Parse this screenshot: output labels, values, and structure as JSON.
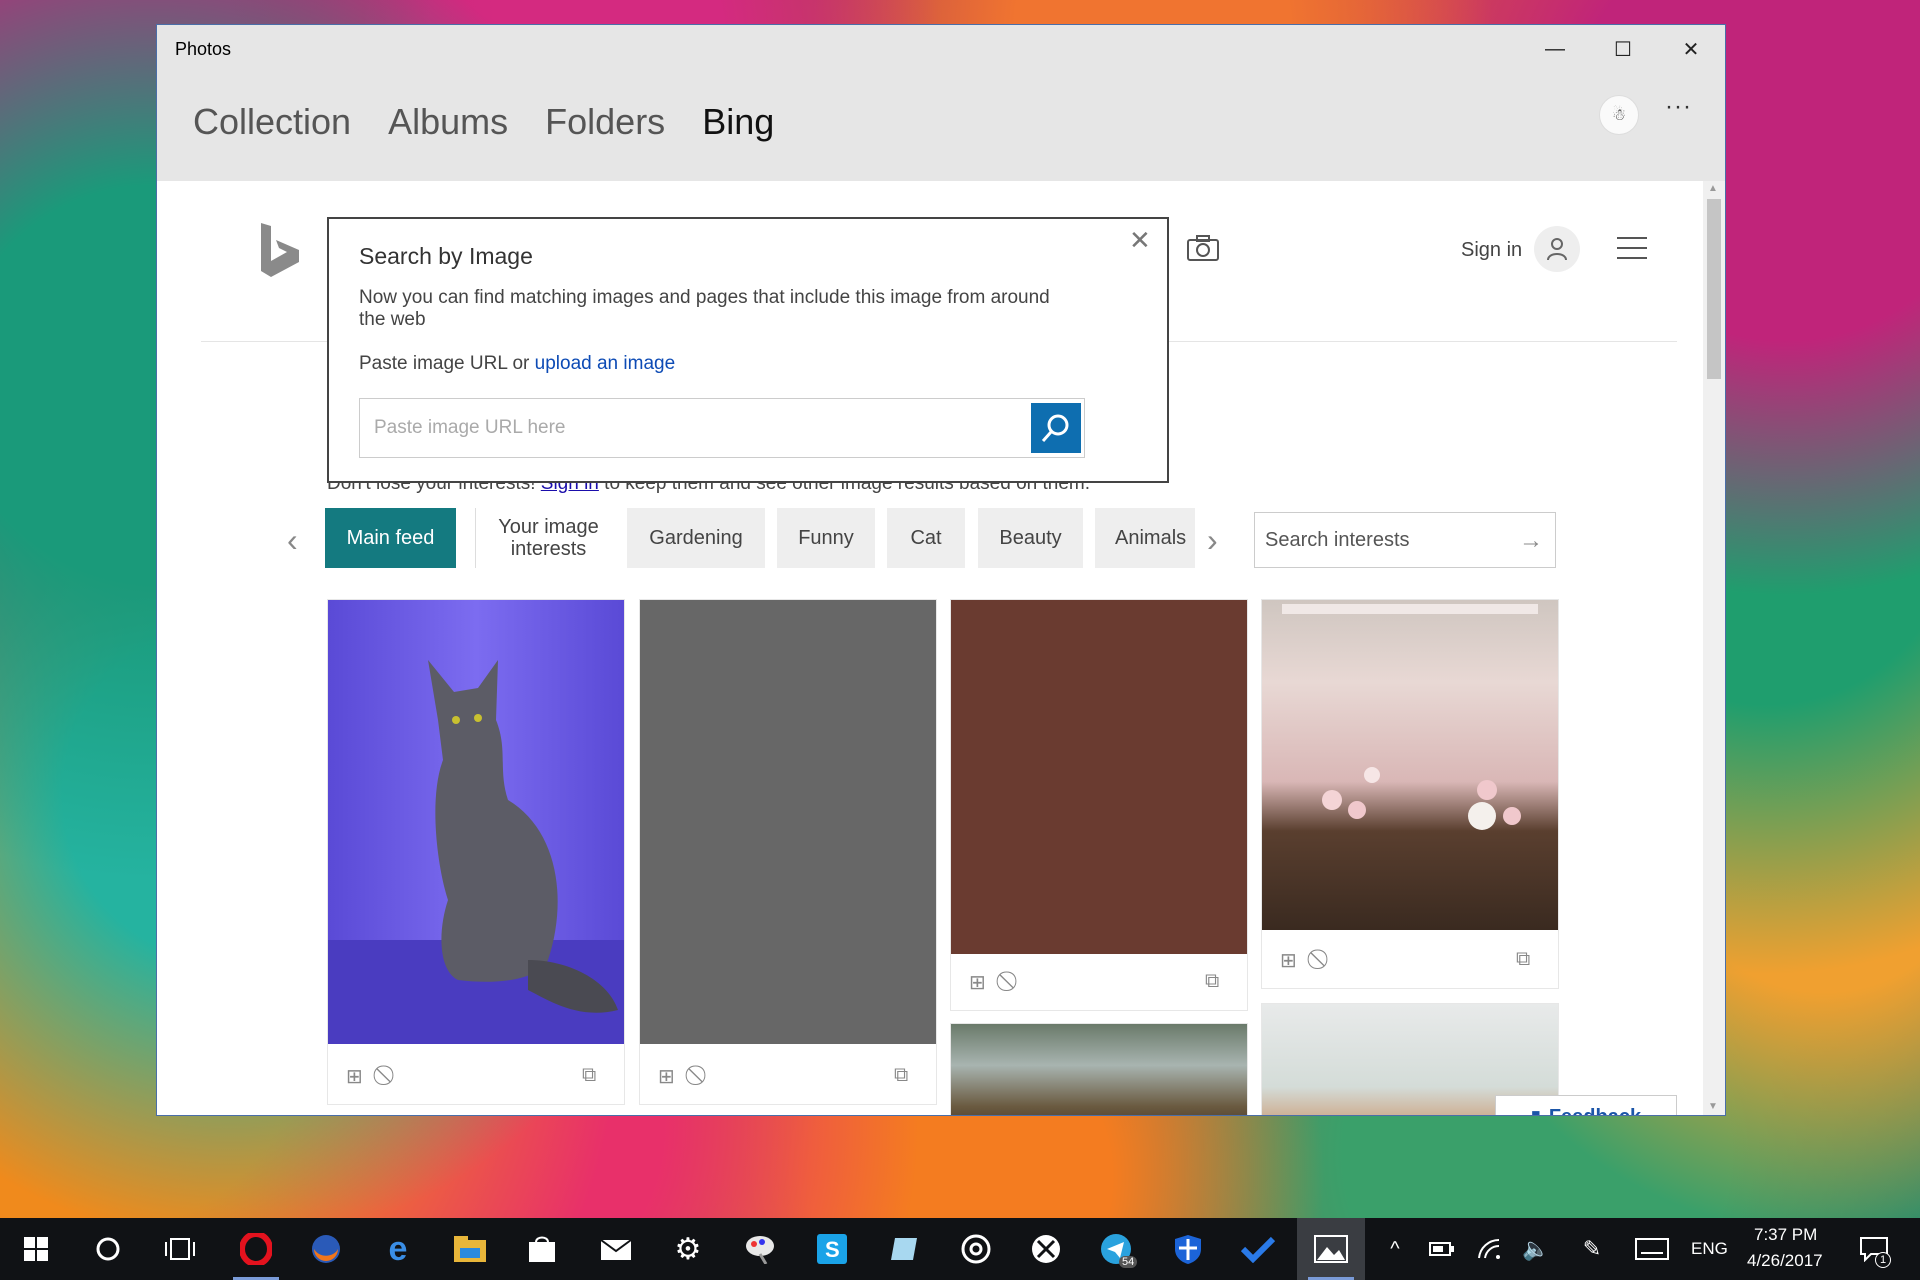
{
  "window": {
    "title": "Photos",
    "controls": [
      "—",
      "☐",
      "✕"
    ]
  },
  "nav": {
    "tabs": [
      {
        "label": "Collection",
        "active": false
      },
      {
        "label": "Albums",
        "active": false
      },
      {
        "label": "Folders",
        "active": false
      },
      {
        "label": "Bing",
        "active": true
      }
    ]
  },
  "bing": {
    "signin_label": "Sign in",
    "note_prefix": "Don't lose your interests! ",
    "note_link": "Sign in",
    "note_suffix": " to keep them and see other image results based on them."
  },
  "popup": {
    "title": "Search by Image",
    "description": "Now you can find matching images and pages that include this image from around the web",
    "paste_prefix": "Paste image URL or ",
    "upload_link": "upload an image",
    "input_placeholder": "Paste image URL here",
    "close_glyph": "✕"
  },
  "chips": [
    {
      "label": "Main feed"
    },
    {
      "label": "Your image interests"
    },
    {
      "label": "Gardening"
    },
    {
      "label": "Funny"
    },
    {
      "label": "Cat"
    },
    {
      "label": "Beauty"
    },
    {
      "label": "Animals"
    }
  ],
  "search_interests": {
    "placeholder": "Search interests"
  },
  "feedback": {
    "label": "Feedback"
  },
  "colors": {
    "accent": "#147a80",
    "link": "#0d4bb5",
    "search_button": "#0e6eb0"
  },
  "taskbar": {
    "language": "ENG",
    "time": "7:37 PM",
    "date": "4/26/2017",
    "telegram_badge": "54",
    "notification_count": "1"
  }
}
